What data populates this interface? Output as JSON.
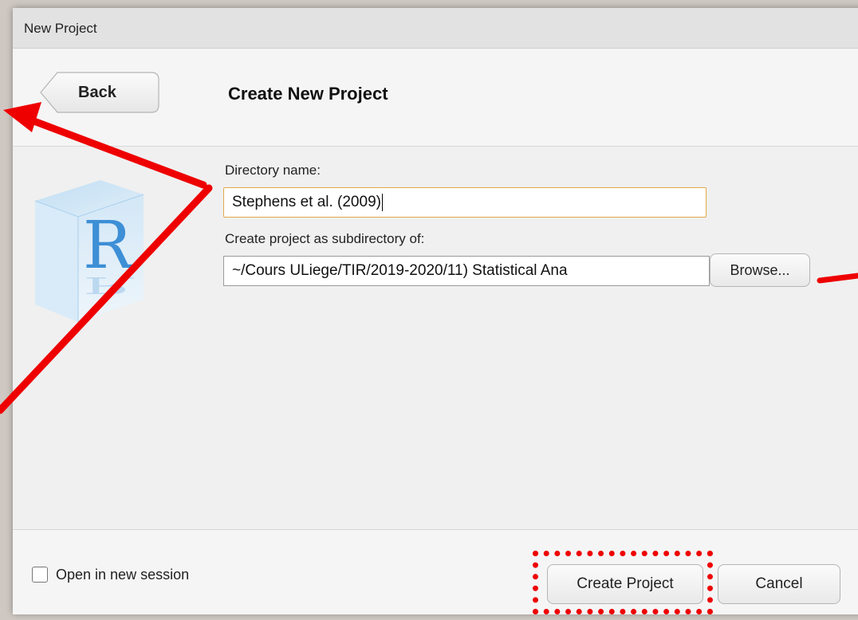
{
  "window": {
    "title": "New Project"
  },
  "header": {
    "back_label": "Back",
    "heading": "Create New Project"
  },
  "form": {
    "directory_label": "Directory name:",
    "directory_value": "Stephens et al. (2009)",
    "subdirectory_label": "Create project as subdirectory of:",
    "subdirectory_value": "~/Cours ULiege/TIR/2019-2020/11) Statistical Ana",
    "browse_label": "Browse..."
  },
  "footer": {
    "open_new_session_label": "Open in new session",
    "open_new_session_checked": false,
    "create_label": "Create Project",
    "cancel_label": "Cancel"
  },
  "annotations": {
    "arrow_color": "#ee0000",
    "highlight_color": "#ee0000"
  },
  "icons": {
    "logo": "r-cube-logo"
  }
}
